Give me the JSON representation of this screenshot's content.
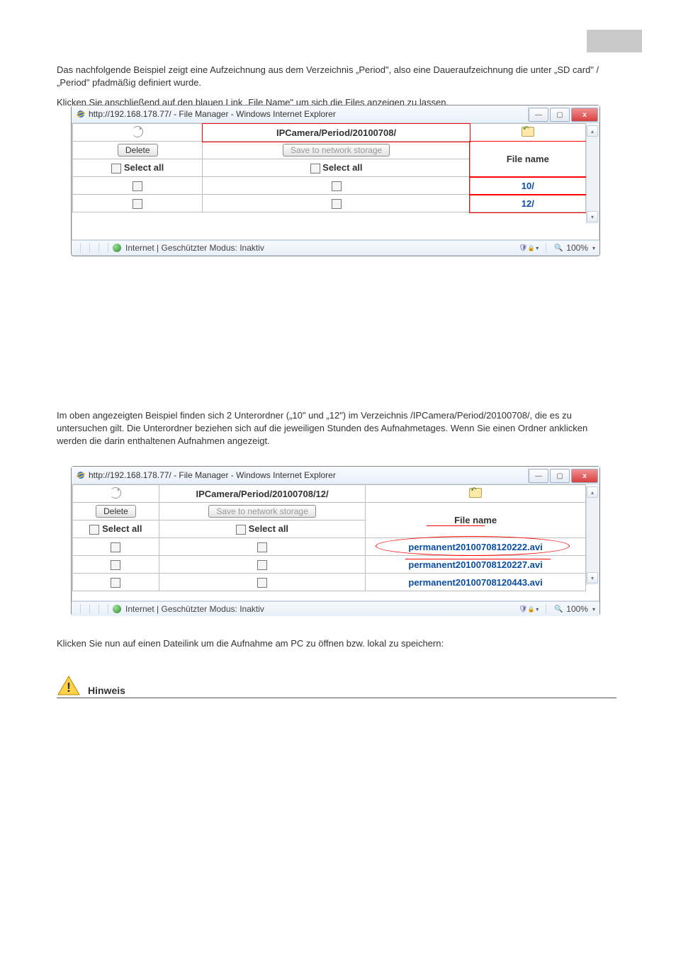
{
  "page_header_label": "",
  "intro1": "Das nachfolgende Beispiel zeigt eine Aufzeichnung aus dem Verzeichnis „Period\", also eine Daueraufzeichnung die unter „SD card\" / „Period\" pfadmäßig definiert wurde.",
  "intro2": "Klicken Sie anschließend auf den blauen Link „File Name\" um sich die Files anzeigen zu lassen.",
  "win1": {
    "title": "http://192.168.178.77/ - File Manager - Windows Internet Explorer",
    "path": "IPCamera/Period/20100708/",
    "delete": "Delete",
    "save_net": "Save to network storage",
    "select_all": "Select all",
    "filename_header": "File name",
    "row1": "10/",
    "row2": "12/",
    "status": "Internet | Geschützter Modus: Inaktiv",
    "zoom": "100%"
  },
  "mid_text": "Im oben angezeigten Beispiel finden sich 2 Unterordner („10\" und „12\") im Verzeichnis /IPCamera/Period/20100708/, die es zu untersuchen gilt. Die Unterordner beziehen sich auf die jeweiligen Stunden des Aufnahmetages. Wenn Sie einen Ordner anklicken werden die darin enthaltenen Aufnahmen angezeigt.",
  "win2": {
    "title": "http://192.168.178.77/ - File Manager - Windows Internet Explorer",
    "path": "IPCamera/Period/20100708/12/",
    "delete": "Delete",
    "save_net": "Save to network storage",
    "select_all": "Select all",
    "filename_header": "File name",
    "rows": [
      "permanent20100708120222.avi",
      "permanent20100708120227.avi",
      "permanent20100708120443.avi"
    ],
    "status": "Internet | Geschützter Modus: Inaktiv",
    "zoom": "100%"
  },
  "after_text": "Klicken Sie nun auf einen Dateilink um die Aufnahme am PC zu öffnen bzw. lokal zu speichern:",
  "note_label": "Hinweis"
}
